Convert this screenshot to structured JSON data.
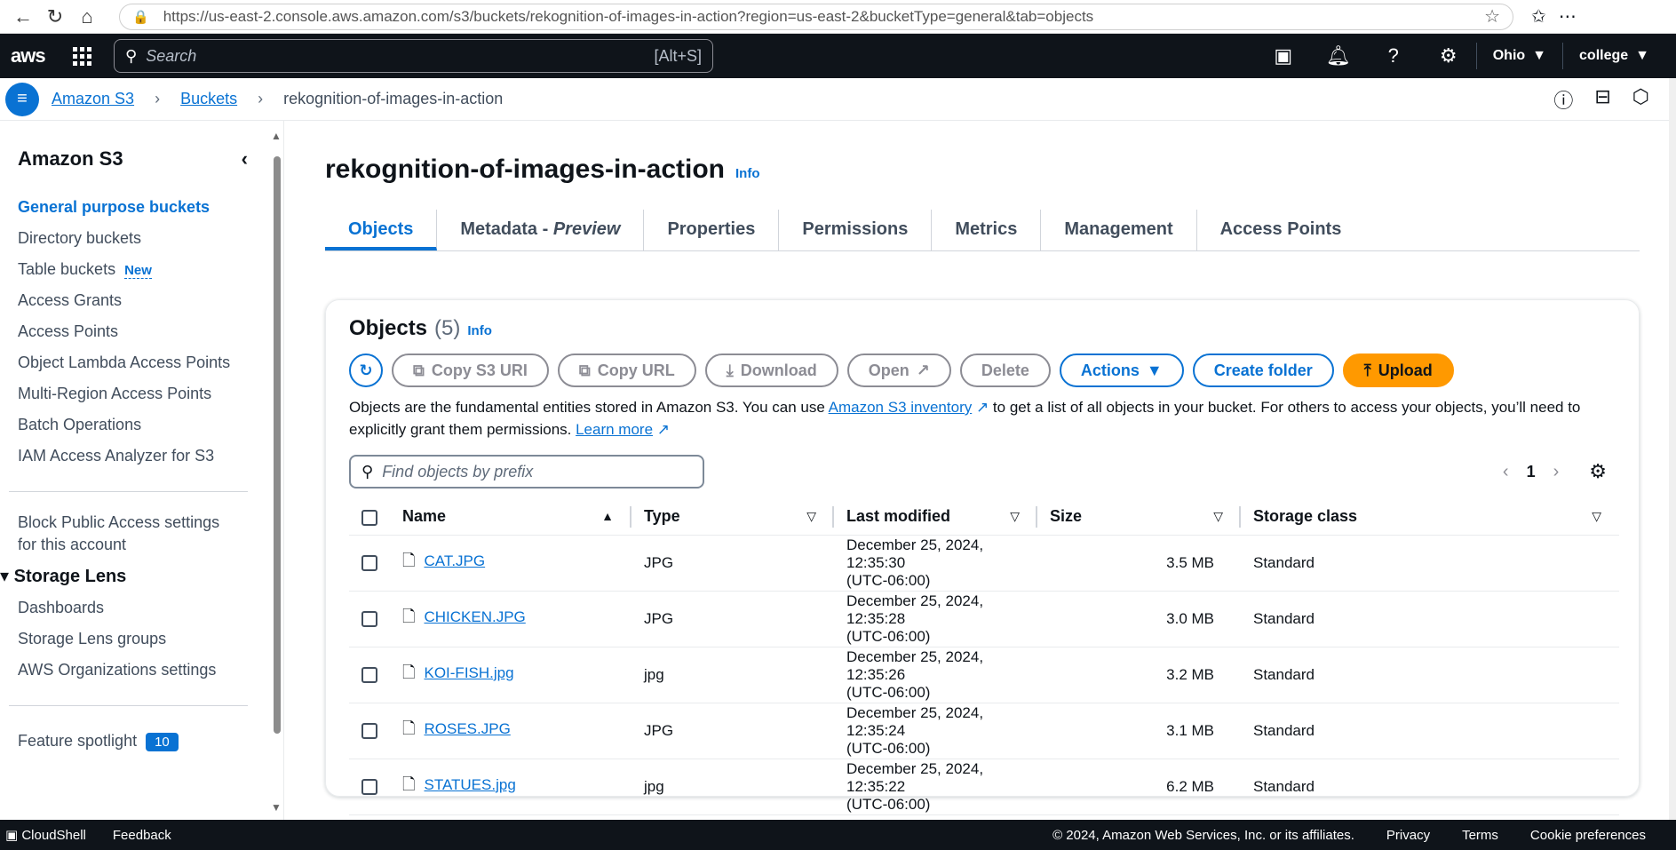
{
  "browser": {
    "url": "https://us-east-2.console.aws.amazon.com/s3/buckets/rekognition-of-images-in-action?region=us-east-2&bucketType=general&tab=objects"
  },
  "topnav": {
    "logo": "aws",
    "search_placeholder": "Search",
    "search_shortcut": "[Alt+S]",
    "region": "Ohio",
    "account": "college"
  },
  "breadcrumb": {
    "items": [
      "Amazon S3",
      "Buckets"
    ],
    "current": "rekognition-of-images-in-action"
  },
  "sidebar": {
    "title": "Amazon S3",
    "items": [
      "General purpose buckets",
      "Directory buckets",
      "Table buckets",
      "Access Grants",
      "Access Points",
      "Object Lambda Access Points",
      "Multi-Region Access Points",
      "Batch Operations",
      "IAM Access Analyzer for S3"
    ],
    "new_tag": "New",
    "block_public": "Block Public Access settings for this account",
    "lens_header": "Storage Lens",
    "lens_items": [
      "Dashboards",
      "Storage Lens groups",
      "AWS Organizations settings"
    ],
    "spotlight": "Feature spotlight",
    "spotlight_count": "10"
  },
  "page": {
    "title": "rekognition-of-images-in-action",
    "info": "Info",
    "tabs": [
      "Objects",
      "Metadata - ",
      "Properties",
      "Permissions",
      "Metrics",
      "Management",
      "Access Points"
    ],
    "tab_preview": "Preview"
  },
  "objects": {
    "heading": "Objects",
    "count": "(5)",
    "info": "Info",
    "buttons": {
      "copy_uri": "Copy S3 URI",
      "copy_url": "Copy URL",
      "download": "Download",
      "open": "Open",
      "delete": "Delete",
      "actions": "Actions",
      "create_folder": "Create folder",
      "upload": "Upload"
    },
    "desc_1": "Objects are the fundamental entities stored in Amazon S3. You can use ",
    "desc_link1": "Amazon S3 inventory",
    "desc_2": " to get a list of all objects in your bucket. For others to access your objects, you’ll need to explicitly grant them permissions. ",
    "desc_link2": "Learn more",
    "filter_placeholder": "Find objects by prefix",
    "page": "1",
    "columns": [
      "Name",
      "Type",
      "Last modified",
      "Size",
      "Storage class"
    ],
    "rows": [
      {
        "name": "CAT.JPG",
        "type": "JPG",
        "modified": "December 25, 2024, 12:35:30",
        "tz": "(UTC-06:00)",
        "size": "3.5 MB",
        "class": "Standard"
      },
      {
        "name": "CHICKEN.JPG",
        "type": "JPG",
        "modified": "December 25, 2024, 12:35:28",
        "tz": "(UTC-06:00)",
        "size": "3.0 MB",
        "class": "Standard"
      },
      {
        "name": "KOI-FISH.jpg",
        "type": "jpg",
        "modified": "December 25, 2024, 12:35:26",
        "tz": "(UTC-06:00)",
        "size": "3.2 MB",
        "class": "Standard"
      },
      {
        "name": "ROSES.JPG",
        "type": "JPG",
        "modified": "December 25, 2024, 12:35:24",
        "tz": "(UTC-06:00)",
        "size": "3.1 MB",
        "class": "Standard"
      },
      {
        "name": "STATUES.jpg",
        "type": "jpg",
        "modified": "December 25, 2024, 12:35:22",
        "tz": "(UTC-06:00)",
        "size": "6.2 MB",
        "class": "Standard"
      }
    ]
  },
  "footer": {
    "cloudshell": "CloudShell",
    "feedback": "Feedback",
    "copyright": "© 2024, Amazon Web Services, Inc. or its affiliates.",
    "privacy": "Privacy",
    "terms": "Terms",
    "cookies": "Cookie preferences"
  },
  "colors": {
    "accent": "#0972d3",
    "primary": "#ff9900",
    "nav": "#0f141a"
  }
}
